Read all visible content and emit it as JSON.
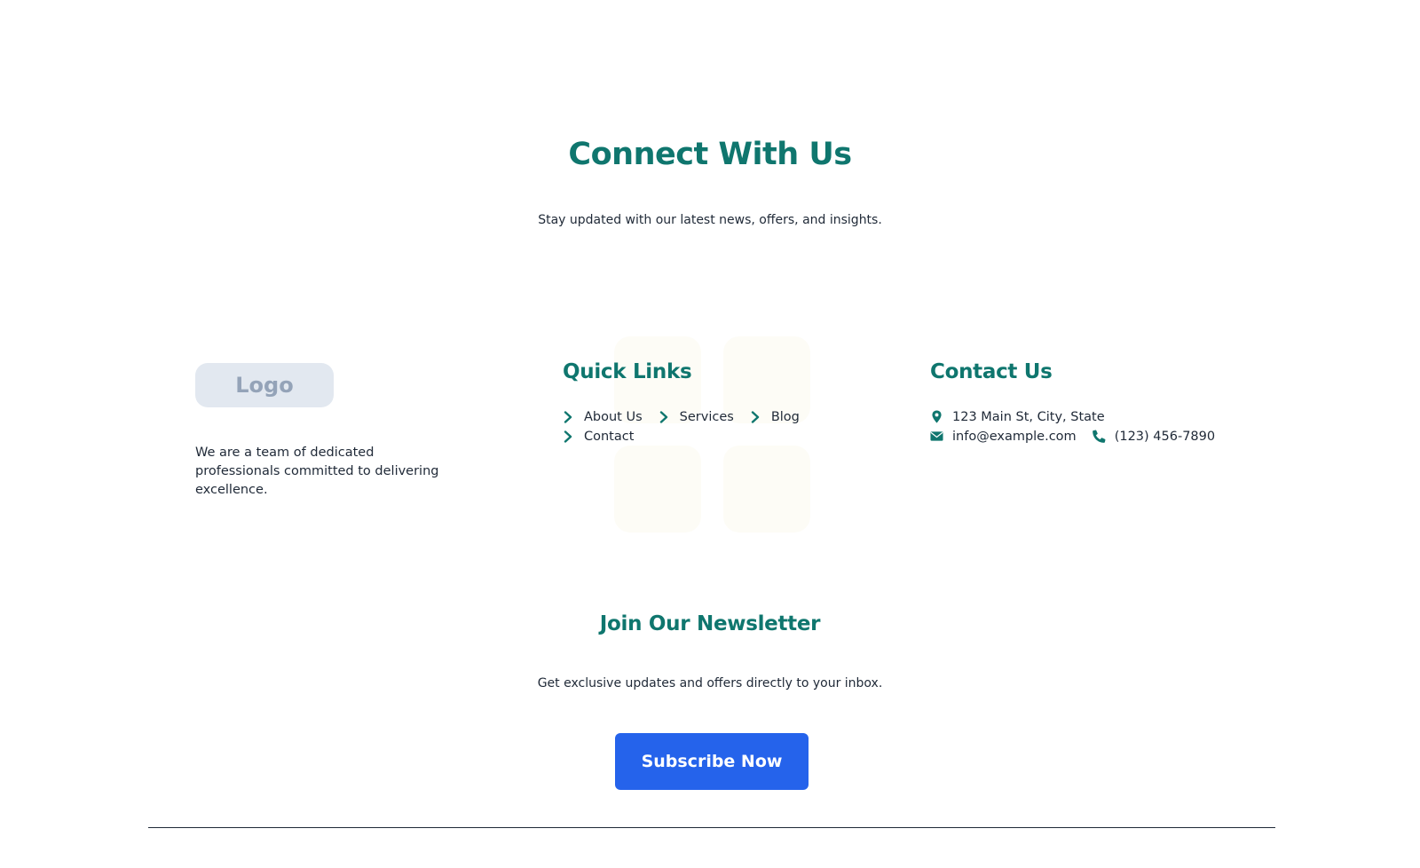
{
  "hero": {
    "title": "Connect With Us",
    "subtitle": "Stay updated with our latest news, offers, and insights."
  },
  "brand": {
    "logo_text": "Logo",
    "about": "We are a team of dedicated professionals committed to delivering excellence."
  },
  "quick_links": {
    "title": "Quick Links",
    "items": [
      {
        "label": "About Us",
        "icon": "chevron-right-icon"
      },
      {
        "label": "Services",
        "icon": "chevron-right-icon"
      },
      {
        "label": "Blog",
        "icon": "chevron-right-icon"
      },
      {
        "label": "Contact",
        "icon": "chevron-right-icon"
      }
    ]
  },
  "contact": {
    "title": "Contact Us",
    "address": "123 Main St, City, State",
    "email": "info@example.com",
    "phone": "(123) 456-7890",
    "icons": [
      "map-pin-icon",
      "envelope-icon",
      "phone-icon"
    ]
  },
  "newsletter": {
    "title": "Join Our Newsletter",
    "subtitle": "Get exclusive updates and offers directly to your inbox.",
    "button_label": "Subscribe Now"
  },
  "colors": {
    "accent": "#0f766e",
    "button": "#2563eb",
    "text": "#1f2937",
    "logo_bg": "#e2e8f0",
    "logo_text": "#94a3b8"
  }
}
